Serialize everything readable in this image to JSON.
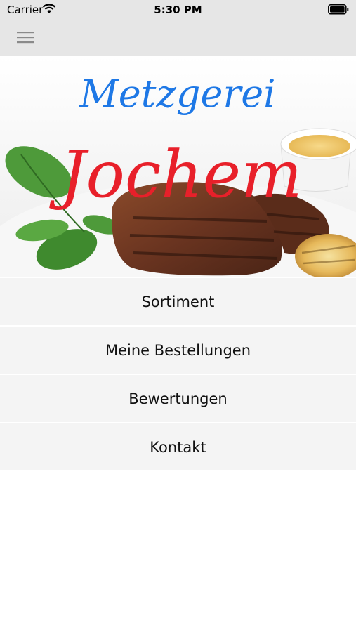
{
  "status": {
    "carrier": "Carrier",
    "time": "5:30 PM"
  },
  "header": {
    "menu_icon": "hamburger-menu-icon"
  },
  "banner": {
    "line1": "Metzgerei",
    "line2": "Jochem",
    "line1_color": "#1e78e6",
    "line2_color": "#e8202a"
  },
  "menu": [
    {
      "label": "Sortiment"
    },
    {
      "label": "Meine Bestellungen"
    },
    {
      "label": "Bewertungen"
    },
    {
      "label": "Kontakt"
    }
  ],
  "colors": {
    "bar_bg": "#e6e6e6",
    "item_bg": "#f4f4f4"
  }
}
